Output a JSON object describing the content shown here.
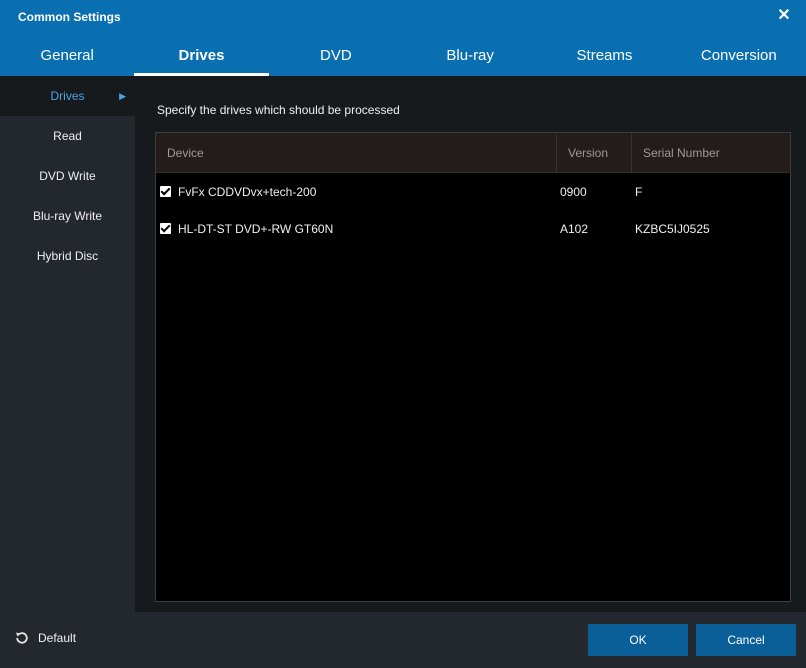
{
  "window": {
    "title": "Common Settings",
    "close_glyph": "✕"
  },
  "tabs": [
    {
      "label": "General"
    },
    {
      "label": "Drives"
    },
    {
      "label": "DVD"
    },
    {
      "label": "Blu-ray"
    },
    {
      "label": "Streams"
    },
    {
      "label": "Conversion"
    }
  ],
  "active_tab": "Drives",
  "sidebar": {
    "items": [
      {
        "label": "Drives"
      },
      {
        "label": "Read"
      },
      {
        "label": "DVD Write"
      },
      {
        "label": "Blu-ray Write"
      },
      {
        "label": "Hybrid Disc"
      }
    ],
    "active_item": "Drives"
  },
  "main": {
    "instruction": "Specify the drives which should be processed",
    "columns": {
      "device": "Device",
      "version": "Version",
      "serial": "Serial Number"
    },
    "rows": [
      {
        "checked": true,
        "device": "FvFx CDDVDvx+tech-200",
        "version": "0900",
        "serial": "F"
      },
      {
        "checked": true,
        "device": "HL-DT-ST DVD+-RW GT60N",
        "version": "A102",
        "serial": "KZBC5IJ0525"
      }
    ]
  },
  "footer": {
    "default_label": "Default",
    "ok_label": "OK",
    "cancel_label": "Cancel"
  },
  "colors": {
    "accent": "#0a6fb0",
    "button": "#0a5f99",
    "sidebar_active_text": "#4ba3e3",
    "background": "#161a1d"
  },
  "icons": {
    "close": "close-icon",
    "default": "reset-icon",
    "sidebar_active": "chevron-right-icon",
    "checkbox": "checkbox-checked-icon"
  }
}
